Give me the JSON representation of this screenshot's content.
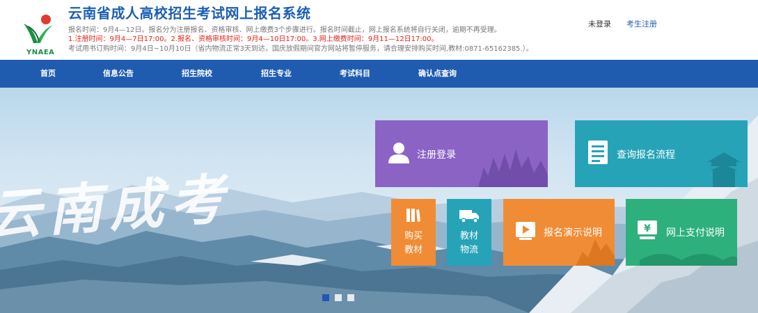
{
  "header": {
    "logo_text": "YNAEA",
    "title": "云南省成人高校招生考试网上报名系统",
    "notice_line1": "报名时间：9月4—12日。报名分为注册报名、资格审核、网上缴费3个步骤进行。报名时间截止，网上报名系统将自行关闭，逾期不再受理。",
    "notice_line2": "1.注册时间：9月4—7日17:00。2.报名、资格审核时间：9月4—10日17:00。3.网上缴费时间：9月11—12日17:00。",
    "notice_line3": "考试用书订购时间：9月4日~10月10日（省内物流正常3天到达，国庆放假期间官方网站将暂停服务，请合理安排购买时间,教材:0871-65162385.）。",
    "login_status": "未登录",
    "register_link": "考生注册"
  },
  "nav": {
    "items": [
      "首页",
      "信息公告",
      "招生院校",
      "招生专业",
      "考试科目",
      "确认点查询"
    ]
  },
  "banner": {
    "watermark": "云南成考",
    "tiles": {
      "register_login": "注册登录",
      "process_query": "查询报名流程",
      "buy_books_line1": "购买",
      "buy_books_line2": "教材",
      "books_logistics_line1": "教材",
      "books_logistics_line2": "物流",
      "demo_guide": "报名演示说明",
      "payment_guide": "网上支付说明"
    },
    "slider_total": 3,
    "slider_active": 1
  },
  "colors": {
    "brand_blue": "#1f5cb0",
    "title_blue": "#1d5fb4",
    "alert_red": "#e0221a",
    "tile_purple": "#8a63c4",
    "tile_teal": "#27a3b8",
    "tile_orange": "#f08c35",
    "tile_green": "#2db07c"
  },
  "icons": {
    "register_login": "user-icon",
    "process_query": "document-list-icon",
    "buy_books": "books-icon",
    "books_logistics": "truck-icon",
    "demo_guide": "video-play-icon",
    "payment_guide": "yen-payment-icon"
  }
}
